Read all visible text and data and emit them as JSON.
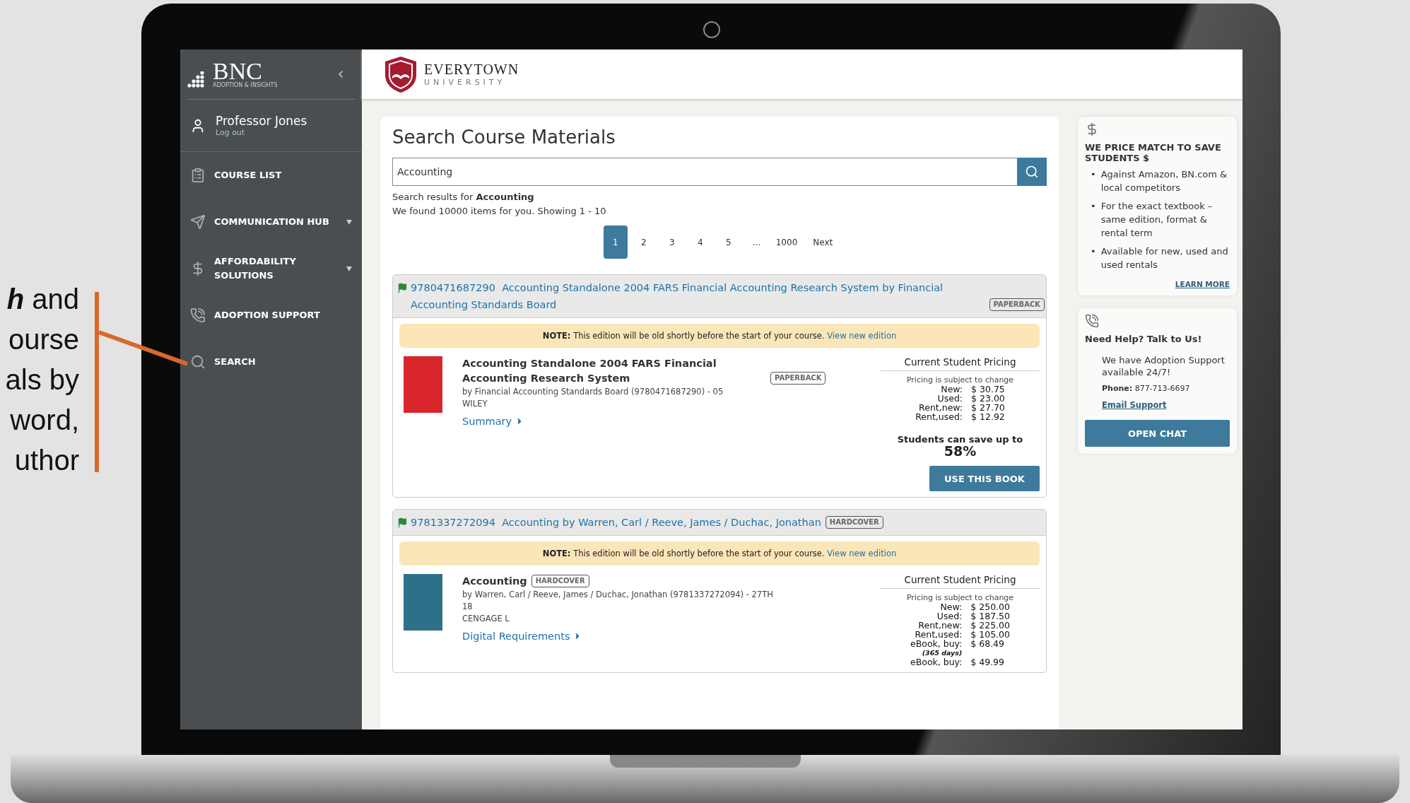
{
  "callout": {
    "lines": [
      "**h** and",
      "ourse",
      "als by",
      "word,",
      "uthor"
    ]
  },
  "sidebar": {
    "logo": {
      "name": "BNC",
      "tagline": "ADOPTION & INSIGHTS"
    },
    "user": {
      "name": "Professor Jones",
      "logout": "Log out"
    },
    "items": [
      {
        "label": "COURSE LIST",
        "has_dropdown": false
      },
      {
        "label": "COMMUNICATION HUB",
        "has_dropdown": true
      },
      {
        "label": "AFFORDABILITY SOLUTIONS",
        "has_dropdown": true
      },
      {
        "label": "ADOPTION SUPPORT",
        "has_dropdown": false
      },
      {
        "label": "SEARCH",
        "has_dropdown": false
      }
    ]
  },
  "header": {
    "university": "EVERYTOWN",
    "subtitle": "UNIVERSITY"
  },
  "search": {
    "title": "Search Course Materials",
    "query": "Accounting",
    "results_for": "Search results for **Accounting**",
    "found": "We found 10000 items for you. Showing 1 - 10",
    "pages": [
      {
        "label": "1",
        "selected": true
      },
      {
        "label": "2",
        "selected": false
      },
      {
        "label": "3",
        "selected": false
      },
      {
        "label": "4",
        "selected": false
      },
      {
        "label": "5",
        "selected": false
      },
      {
        "label": "...",
        "selected": false
      },
      {
        "label": "1000",
        "selected": false
      }
    ],
    "next": "Next"
  },
  "results": [
    {
      "isbn": "9780471687290",
      "heading": "Accounting Standalone 2004 FARS Financial Accounting Research System by Financial Accounting Standards Board",
      "binding": "PAPERBACK",
      "note": {
        "label": "NOTE:",
        "text": "This edition will be old shortly before the start of your course.",
        "link": "View new edition"
      },
      "title": "Accounting Standalone 2004 FARS Financial Accounting Research System",
      "title_binding": "PAPERBACK",
      "details": [
        "by Financial Accounting Standards Board (9780471687290) - 05",
        "WILEY"
      ],
      "toggle": "Summary",
      "pricing": {
        "heading": "Current Student Pricing",
        "subtitle": "Pricing is subject to change",
        "rows": [
          {
            "label": "New:",
            "value": "$ 30.75"
          },
          {
            "label": "Used:",
            "value": "$ 23.00"
          },
          {
            "label": "Rent,new:",
            "value": "$ 27.70"
          },
          {
            "label": "Rent,used:",
            "value": "$ 12.92"
          }
        ],
        "savings": "Students can save up to",
        "percent": "58%",
        "button": "USE THIS BOOK"
      }
    },
    {
      "isbn": "9781337272094",
      "heading": "Accounting by Warren, Carl / Reeve, James / Duchac, Jonathan",
      "binding": "HARDCOVER",
      "note": {
        "label": "NOTE:",
        "text": "This edition will be old shortly before the start of your course.",
        "link": "View new edition"
      },
      "title": "Accounting",
      "title_binding": "HARDCOVER",
      "details": [
        "by Warren, Carl / Reeve, James / Duchac, Jonathan (9781337272094) - 27TH",
        "18",
        "CENGAGE L"
      ],
      "toggle": "Digital Requirements",
      "pricing": {
        "heading": "Current Student Pricing",
        "subtitle": "Pricing is subject to change",
        "rows": [
          {
            "label": "New:",
            "value": "$ 250.00"
          },
          {
            "label": "Used:",
            "value": "$ 187.50"
          },
          {
            "label": "Rent,new:",
            "value": "$ 225.00"
          },
          {
            "label": "Rent,used:",
            "value": "$ 105.00"
          },
          {
            "label": "eBook, buy:",
            "value": "$ 68.49",
            "note": "(365 days)"
          },
          {
            "label": "eBook, buy:",
            "value": "$ 49.99"
          }
        ]
      }
    }
  ],
  "price_match": {
    "title": "WE PRICE MATCH TO SAVE STUDENTS $",
    "bullets": [
      {
        "marker": "•",
        "text": "Against Amazon, BN.com & local competitors"
      },
      {
        "marker": "•",
        "text": "For the exact textbook – same edition, format & rental term"
      },
      {
        "marker": "•",
        "text": "Available for new, used and used rentals"
      }
    ],
    "link": "LEARN MORE"
  },
  "help": {
    "title": "Need Help? Talk to Us!",
    "text": "We have Adoption Support available 24/7!",
    "phone_label": "Phone:",
    "phone": "877-713-6697",
    "email": "Email Support",
    "button": "OPEN CHAT"
  }
}
